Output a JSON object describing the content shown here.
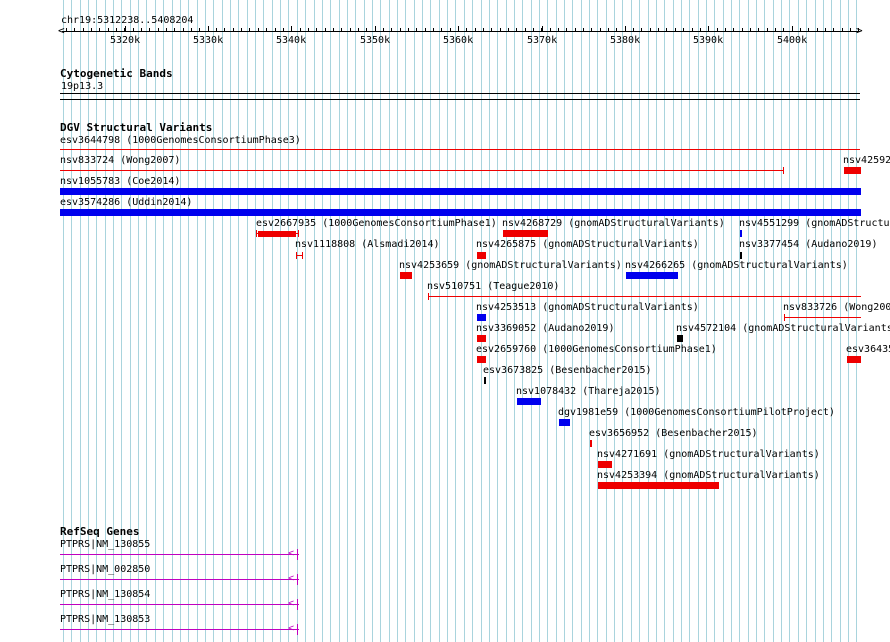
{
  "ruler": {
    "position_label": "chr19:5312238..5408204",
    "ticks": [
      "5320k",
      "5330k",
      "5340k",
      "5350k",
      "5360k",
      "5370k",
      "5380k",
      "5390k",
      "5400k"
    ]
  },
  "cytoband": {
    "title": "Cytogenetic Bands",
    "band": "19p13.3"
  },
  "dgv": {
    "title": "DGV Structural Variants",
    "features": [
      {
        "label": "esv3644798 (1000GenomesConsortiumPhase3)",
        "color": "#ee0000"
      },
      {
        "label": "nsv833724 (Wong2007)",
        "color": "#ee0000"
      },
      {
        "label": "nsv42592",
        "color": "#ee0000"
      },
      {
        "label": "nsv1055783 (Coe2014)",
        "color": "#0000ee"
      },
      {
        "label": "esv3574286 (Uddin2014)",
        "color": "#0000ee"
      },
      {
        "label": "esv2667935 (1000GenomesConsortiumPhase1)",
        "color": "#ee0000"
      },
      {
        "label": "nsv4268729 (gnomADStructuralVariants)",
        "color": "#ee0000"
      },
      {
        "label": "nsv4551299 (gnomADStructu",
        "color": "#0000ee"
      },
      {
        "label": "nsv1118808 (Alsmadi2014)",
        "color": "#ee0000"
      },
      {
        "label": "nsv4265875 (gnomADStructuralVariants)",
        "color": "#ee0000"
      },
      {
        "label": "nsv3377454 (Audano2019)",
        "color": "#000000"
      },
      {
        "label": "nsv4253659 (gnomADStructuralVariants)",
        "color": "#ee0000"
      },
      {
        "label": "nsv4266265 (gnomADStructuralVariants)",
        "color": "#0000ee"
      },
      {
        "label": "nsv510751 (Teague2010)",
        "color": "#ee0000"
      },
      {
        "label": "nsv4253513 (gnomADStructuralVariants)",
        "color": "#0000ee"
      },
      {
        "label": "nsv833726 (Wong200",
        "color": "#ee0000"
      },
      {
        "label": "nsv3369052 (Audano2019)",
        "color": "#ee0000"
      },
      {
        "label": "nsv4572104 (gnomADStructuralVariants",
        "color": "#000000"
      },
      {
        "label": "esv2659760 (1000GenomesConsortiumPhase1)",
        "color": "#ee0000"
      },
      {
        "label": "esv36435",
        "color": "#ee0000"
      },
      {
        "label": "esv3673825 (Besenbacher2015)",
        "color": "#000000"
      },
      {
        "label": "nsv1078432 (Thareja2015)",
        "color": "#0000ee"
      },
      {
        "label": "dgv1981e59 (1000GenomesConsortiumPilotProject)",
        "color": "#0000ee"
      },
      {
        "label": "esv3656952 (Besenbacher2015)",
        "color": "#ee0000"
      },
      {
        "label": "nsv4271691 (gnomADStructuralVariants)",
        "color": "#ee0000"
      },
      {
        "label": "nsv4253394 (gnomADStructuralVariants)",
        "color": "#ee0000"
      }
    ]
  },
  "refseq": {
    "title": "RefSeq Genes",
    "genes": [
      {
        "label": "PTPRS|NM_130855"
      },
      {
        "label": "PTPRS|NM_002850"
      },
      {
        "label": "PTPRS|NM_130854"
      },
      {
        "label": "PTPRS|NM_130853"
      }
    ],
    "color": "#c000c0"
  },
  "colors": {
    "grid": "#a9d4dd",
    "loss": "#ee0000",
    "gain": "#0000ee",
    "complex": "#000000"
  }
}
